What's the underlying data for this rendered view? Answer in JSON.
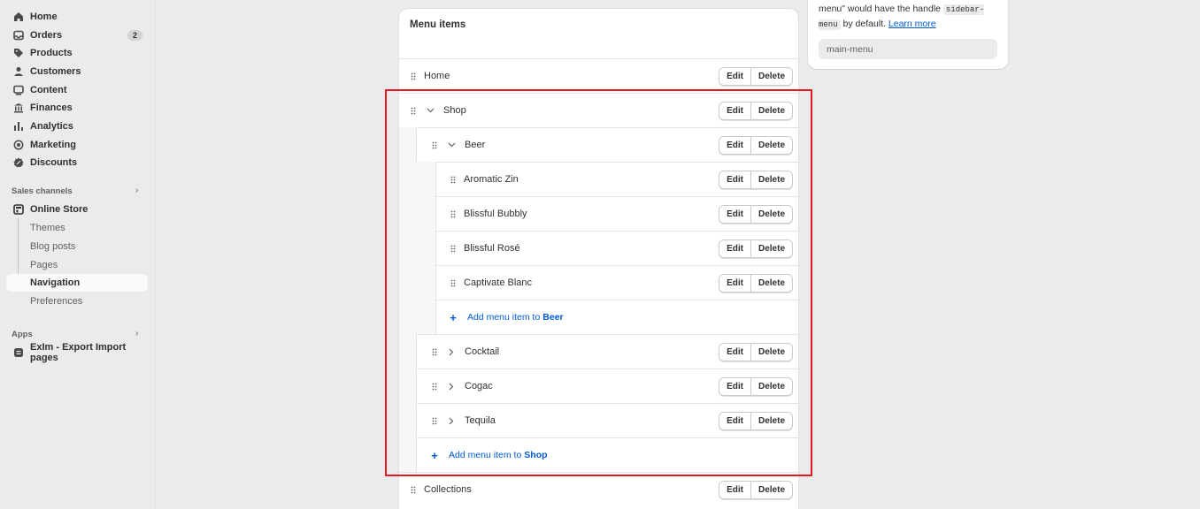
{
  "sidebar": {
    "items": [
      {
        "label": "Home",
        "icon": "home-icon"
      },
      {
        "label": "Orders",
        "icon": "inbox-icon",
        "badge": "2"
      },
      {
        "label": "Products",
        "icon": "tag-icon"
      },
      {
        "label": "Customers",
        "icon": "person-icon"
      },
      {
        "label": "Content",
        "icon": "content-icon"
      },
      {
        "label": "Finances",
        "icon": "bank-icon"
      },
      {
        "label": "Analytics",
        "icon": "chart-bar-icon"
      },
      {
        "label": "Marketing",
        "icon": "target-icon"
      },
      {
        "label": "Discounts",
        "icon": "discount-icon"
      }
    ],
    "sales_channels_label": "Sales channels",
    "online_store": {
      "label": "Online Store",
      "icon": "store-icon"
    },
    "store_subitems": [
      "Themes",
      "Blog posts",
      "Pages",
      "Navigation",
      "Preferences"
    ],
    "apps_label": "Apps",
    "app_item": {
      "label": "ExIm - Export Import pages",
      "icon": "app-icon"
    }
  },
  "menu": {
    "title": "Menu items",
    "edit_label": "Edit",
    "delete_label": "Delete",
    "rows": [
      {
        "label": "Home",
        "chevron": "none"
      },
      {
        "label": "Shop",
        "chevron": "down"
      },
      {
        "label": "Beer",
        "chevron": "down"
      },
      {
        "label": "Aromatic Zin",
        "chevron": "none"
      },
      {
        "label": "Blissful Bubbly",
        "chevron": "none"
      },
      {
        "label": "Blissful Rosé",
        "chevron": "none"
      },
      {
        "label": "Captivate Blanc",
        "chevron": "none"
      },
      {
        "label": "Cocktail",
        "chevron": "right"
      },
      {
        "label": "Cogac",
        "chevron": "right"
      },
      {
        "label": "Tequila",
        "chevron": "right"
      },
      {
        "label": "Collections",
        "chevron": "none"
      }
    ],
    "add_prefix": "Add menu item to",
    "add_beer_target": "Beer",
    "add_shop_target": "Shop"
  },
  "handle_panel": {
    "text_prefix": "menu\" would have the handle",
    "code": "sidebar-menu",
    "text_suffix": "by default.",
    "learn_more": "Learn more",
    "handle_value": "main-menu"
  },
  "colors": {
    "accent": "#005bd3",
    "highlight": "#e3191f"
  }
}
